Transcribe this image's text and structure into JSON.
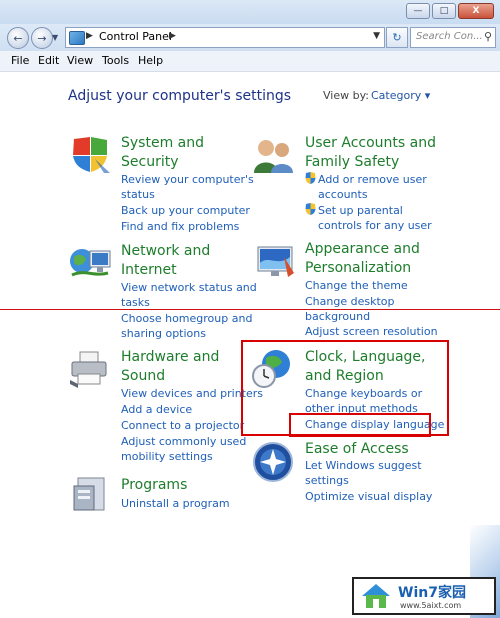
{
  "window": {
    "minimize": "—",
    "maximize": "□",
    "close": "X"
  },
  "address": {
    "back": "←",
    "forward": "→",
    "breadcrumb_sep": "▶",
    "crumb": "Control Panel",
    "dropdown": "▼",
    "refresh": "↻",
    "search_placeholder": "Search Con...",
    "search_icon": "⚲"
  },
  "menu": [
    "File",
    "Edit",
    "View",
    "Tools",
    "Help"
  ],
  "heading": "Adjust your computer's settings",
  "view_by": {
    "label": "View by:",
    "value": "Category ▾"
  },
  "categories": {
    "system": {
      "title": [
        "System and",
        "Security"
      ],
      "links": [
        "Review your computer's",
        "status",
        "Back up your computer",
        "Find and fix problems"
      ]
    },
    "network": {
      "title": [
        "Network and",
        "Internet"
      ],
      "links": [
        "View network status and",
        "tasks",
        "Choose homegroup and",
        "sharing options"
      ]
    },
    "hardware": {
      "title": [
        "Hardware and",
        "Sound"
      ],
      "links": [
        "View devices and printers",
        "Add a device",
        "Connect to a projector",
        "Adjust commonly used",
        "mobility settings"
      ]
    },
    "programs": {
      "title": [
        "Programs"
      ],
      "links": [
        "Uninstall a program"
      ]
    },
    "users": {
      "title": [
        "User Accounts and",
        "Family Safety"
      ],
      "links": [
        "Add or remove user",
        "accounts",
        "Set up parental",
        "controls for any user"
      ]
    },
    "appearance": {
      "title": [
        "Appearance and",
        "Personalization"
      ],
      "links": [
        "Change the theme",
        "Change desktop",
        "background",
        "Adjust screen resolution"
      ]
    },
    "clock": {
      "title": [
        "Clock, Language,",
        "and Region"
      ],
      "links": [
        "Change keyboards or",
        "other input methods",
        "Change display language"
      ]
    },
    "ease": {
      "title": [
        "Ease of Access"
      ],
      "links": [
        "Let Windows suggest",
        "settings",
        "Optimize visual display"
      ]
    }
  },
  "watermark": {
    "title": "Win7家园",
    "url": "www.5aixt.com"
  },
  "colors": {
    "title_green": "#1e7d2c",
    "link_blue": "#1f5fb8",
    "heading_blue": "#1e3287",
    "highlight_red": "#d80000"
  }
}
